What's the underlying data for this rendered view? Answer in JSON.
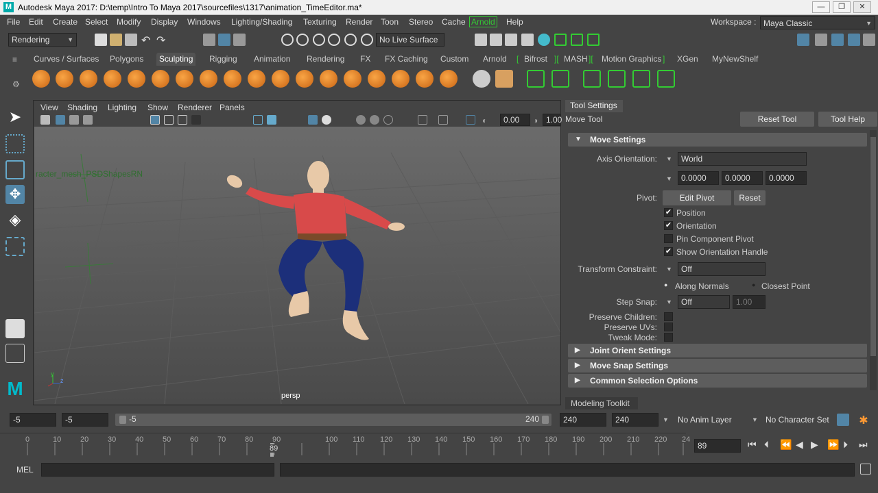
{
  "window": {
    "title": "Autodesk Maya 2017: D:\\temp\\Intro To Maya 2017\\sourcefiles\\1317\\animation_TimeEditor.ma*",
    "logo": "M",
    "minimize": "—",
    "maximize": "❐",
    "close": "✕"
  },
  "menubar": {
    "items": [
      "File",
      "Edit",
      "Create",
      "Select",
      "Modify",
      "Display",
      "Windows",
      "Lighting/Shading",
      "Texturing",
      "Render",
      "Toon",
      "Stereo",
      "Cache",
      "Arnold",
      "Help"
    ],
    "workspace_label": "Workspace :",
    "workspace_value": "Maya Classic"
  },
  "statusline": {
    "menuset": "Rendering",
    "live_surface": "No Live Surface"
  },
  "shelf": {
    "tabs": [
      "Curves / Surfaces",
      "Polygons",
      "Sculpting",
      "Rigging",
      "Animation",
      "Rendering",
      "FX",
      "FX Caching",
      "Custom",
      "Arnold",
      "Bifrost",
      "MASH",
      "Motion Graphics",
      "XGen",
      "MyNewShelf"
    ],
    "active_tab": "Sculpting"
  },
  "viewport": {
    "menus": [
      "View",
      "Shading",
      "Lighting",
      "Show",
      "Renderer",
      "Panels"
    ],
    "near_value": "0.00",
    "far_value": "1.00",
    "object_label": "racter_mesh_PSDShapesRN",
    "camera": "persp",
    "axis_y": "y",
    "axis_z": "z"
  },
  "tool_settings": {
    "panel_title": "Tool Settings",
    "tool_name": "Move Tool",
    "reset_tool": "Reset Tool",
    "tool_help": "Tool Help",
    "section_move": "Move Settings",
    "axis_orientation_label": "Axis Orientation:",
    "axis_orientation_value": "World",
    "axis_values": [
      "0.0000",
      "0.0000",
      "0.0000"
    ],
    "pivot_label": "Pivot:",
    "edit_pivot": "Edit Pivot",
    "reset": "Reset",
    "checks": [
      {
        "label": "Position",
        "checked": true
      },
      {
        "label": "Orientation",
        "checked": true
      },
      {
        "label": "Pin Component Pivot",
        "checked": false
      },
      {
        "label": "Show Orientation Handle",
        "checked": true
      }
    ],
    "transform_constraint_label": "Transform Constraint:",
    "transform_constraint_value": "Off",
    "along_normals": "Along Normals",
    "closest_point": "Closest Point",
    "step_snap_label": "Step Snap:",
    "step_snap_value": "Off",
    "step_snap_amount": "1.00",
    "preserve_children": "Preserve Children:",
    "preserve_uvs": "Preserve UVs:",
    "tweak_mode": "Tweak Mode:",
    "collapsed_sections": [
      "Joint Orient Settings",
      "Move Snap Settings",
      "Common Selection Options"
    ],
    "modeling_toolkit_tab": "Modeling Toolkit"
  },
  "range": {
    "start": "-5",
    "playback_start": "-5",
    "slider_start": "-5",
    "slider_end": "240",
    "playback_end": "240",
    "end": "240",
    "anim_layer": "No Anim Layer",
    "character_set": "No Character Set"
  },
  "timeline": {
    "ticks": [
      "0",
      "10",
      "20",
      "30",
      "40",
      "50",
      "60",
      "70",
      "80",
      "90",
      "100",
      "110",
      "120",
      "130",
      "140",
      "150",
      "160",
      "170",
      "180",
      "190",
      "200",
      "210",
      "220",
      "230",
      "24"
    ],
    "current_frame": "89",
    "current_frame_field": "89"
  },
  "command": {
    "lang": "MEL"
  },
  "colors": {
    "arnold_green": "#33cc33",
    "active_icon": "#5285a6",
    "viewport_bg": "#595959"
  }
}
